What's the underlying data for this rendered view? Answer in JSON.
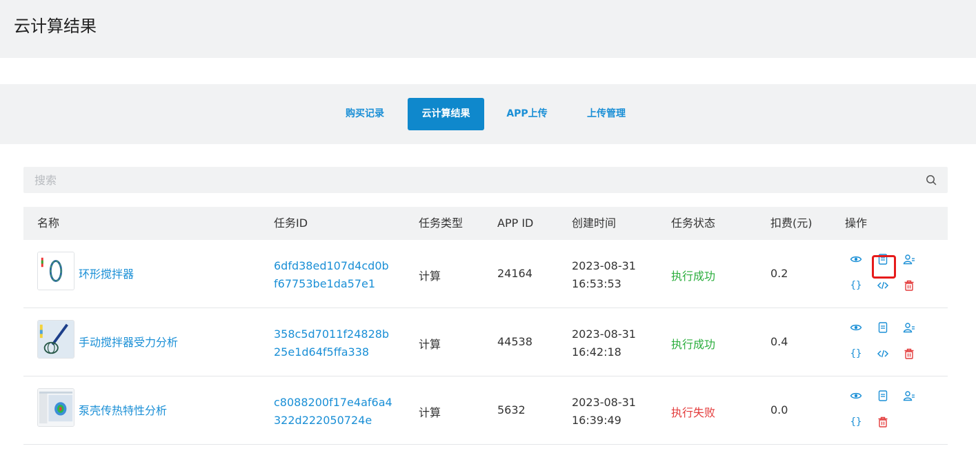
{
  "page": {
    "title": "云计算结果"
  },
  "tabs": [
    {
      "label": "购买记录",
      "active": false
    },
    {
      "label": "云计算结果",
      "active": true
    },
    {
      "label": "APP上传",
      "active": false
    },
    {
      "label": "上传管理",
      "active": false
    }
  ],
  "search": {
    "placeholder": "搜索",
    "value": ""
  },
  "table": {
    "headers": [
      "名称",
      "任务ID",
      "任务类型",
      "APP ID",
      "创建时间",
      "任务状态",
      "扣费(元)",
      "操作"
    ],
    "rows": [
      {
        "name": "环形搅拌器",
        "task_id_line1": "6dfd38ed107d4cd0b",
        "task_id_line2": "f67753be1da57e1",
        "type": "计算",
        "app_id": "24164",
        "date": "2023-08-31",
        "time": "16:53:53",
        "status": "执行成功",
        "status_kind": "success",
        "fee": "0.2",
        "actions": [
          "eye-icon",
          "document-icon",
          "users-icon",
          "braces-icon",
          "code-icon",
          "trash-icon"
        ]
      },
      {
        "name": "手动搅拌器受力分析",
        "task_id_line1": "358c5d7011f24828b",
        "task_id_line2": "25e1d64f5ffa338",
        "type": "计算",
        "app_id": "44538",
        "date": "2023-08-31",
        "time": "16:42:18",
        "status": "执行成功",
        "status_kind": "success",
        "fee": "0.4",
        "actions": [
          "eye-icon",
          "document-icon",
          "users-icon",
          "braces-icon",
          "code-icon",
          "trash-icon"
        ]
      },
      {
        "name": "泵壳传热特性分析",
        "task_id_line1": "c8088200f17e4af6a4",
        "task_id_line2": "322d222050724e",
        "type": "计算",
        "app_id": "5632",
        "date": "2023-08-31",
        "time": "16:39:49",
        "status": "执行失败",
        "status_kind": "failed",
        "fee": "0.0",
        "actions": [
          "eye-icon",
          "document-icon",
          "users-icon",
          "braces-icon",
          "trash-icon"
        ]
      }
    ]
  },
  "colors": {
    "accent": "#0f88cc",
    "link": "#1a8fd6",
    "success": "#2aad3c",
    "danger": "#e33b3b",
    "panel_bg": "#f1f2f3",
    "highlight": "#e61b1b"
  }
}
